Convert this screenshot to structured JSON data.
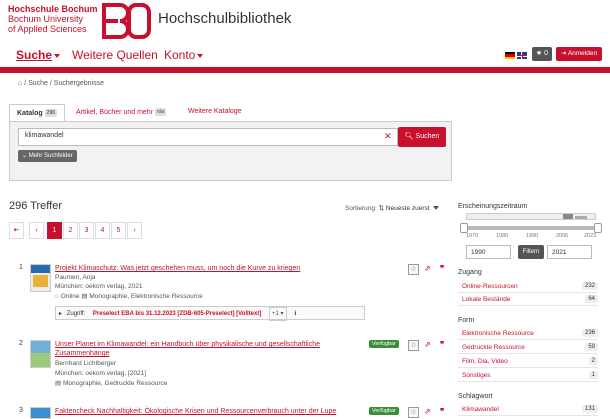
{
  "header": {
    "brand_line1": "Hochschule Bochum",
    "brand_line2": "Bochum University",
    "brand_line3": "of Applied Sciences",
    "library_title": "Hochschulbibliothek",
    "brand_color": "#c8102e"
  },
  "nav": {
    "items": [
      {
        "label": "Suche",
        "active": true
      },
      {
        "label": "Weitere Quellen"
      },
      {
        "label": "Konto"
      }
    ],
    "fav_count": "0",
    "login_label": "Anmelden"
  },
  "breadcrumb": {
    "items": [
      "Suche",
      "Suchergebnisse"
    ],
    "home_icon": "home-icon"
  },
  "search": {
    "tabs": [
      {
        "label": "Katalog",
        "badge": "296"
      },
      {
        "label": "Artikel, Bücher und mehr",
        "badge": "n/a"
      },
      {
        "label": "Weitere Kataloge"
      }
    ],
    "query": "klimawandel",
    "search_button": "Suchen",
    "more_fields_button": "Mehr Suchfelder"
  },
  "results": {
    "hits_label": "296 Treffer",
    "sort_label": "Sortierung:",
    "sort_value": "Neueste zuerst",
    "pages": [
      "1",
      "2",
      "3",
      "4",
      "5"
    ],
    "items": [
      {
        "num": "1",
        "title": "Projekt Klimaschutz: Was jetzt geschehen muss, um noch die Kurve zu kriegen",
        "author": "Paumen, Anja",
        "publisher": "München: oekom verlag, 2021",
        "format": "Online",
        "format2": "Monographie, Elektronische Ressource",
        "access_label": "Zugriff:",
        "access_link": "Preselect EBA bis 31.12.2023 [ZDB-605-Preselect] [Volltext]",
        "access_more": "+1"
      },
      {
        "num": "2",
        "title_line1": "Unser Planet im Klimawandel: ein Handbuch über physikalische und gesellschaftliche",
        "title_line2": "Zusammenhänge",
        "author": "Bernhard Lichtberger",
        "publisher": "München: oekom verlag, [2021]",
        "format2": "Monographie, Gedruckte Ressource",
        "availability": "Verfügbar"
      },
      {
        "num": "3",
        "title": "Faktencheck Nachhaltigkeit: Ökologische Krisen und Ressourcenverbrauch unter der Lupe",
        "availability": "Verfügbar"
      }
    ]
  },
  "sidebar": {
    "year_heading": "Erscheinungszeitraum",
    "year_ticks": [
      "1970",
      "1980",
      "1990",
      "2006",
      "2023"
    ],
    "year_from": "1990",
    "year_to": "2021",
    "filter_button": "Filtern",
    "facets": [
      {
        "heading": "Zugang",
        "rows": [
          {
            "label": "Online-Ressourcen",
            "count": "232"
          },
          {
            "label": "Lokale Bestände",
            "count": "64"
          }
        ]
      },
      {
        "heading": "Form",
        "rows": [
          {
            "label": "Elektronische Ressource",
            "count": "236"
          },
          {
            "label": "Gedruckte Ressource",
            "count": "59"
          },
          {
            "label": "Film, Dia, Video",
            "count": "2"
          },
          {
            "label": "Sonstiges",
            "count": "1"
          }
        ]
      },
      {
        "heading": "Schlagwort",
        "rows": [
          {
            "label": "Klimawandel",
            "count": "131"
          }
        ]
      }
    ]
  }
}
